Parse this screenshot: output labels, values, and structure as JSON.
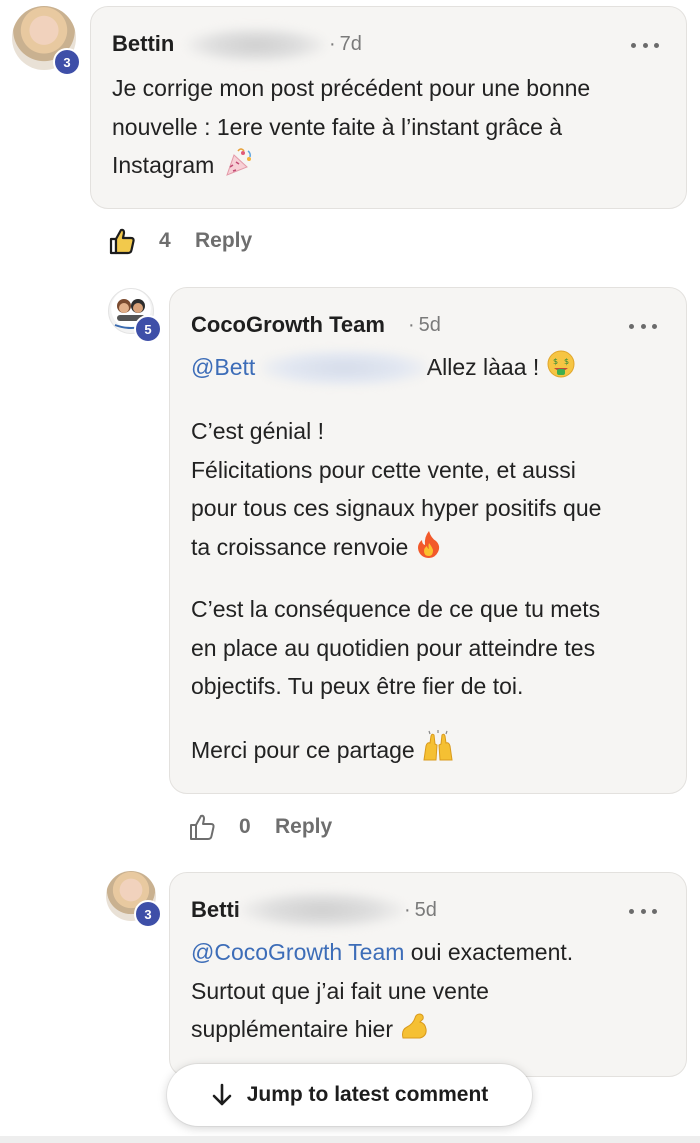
{
  "comments": [
    {
      "author": "Bettin",
      "time": "7d",
      "badge": "3",
      "lines": [
        "Je corrige mon post précédent pour une bonne",
        "nouvelle : 1ere vente faite à l’instant grâce à",
        "Instagram"
      ],
      "emoji_name": "party-popper-icon",
      "likes": "4",
      "reply_label": "Reply"
    },
    {
      "author": "CocoGrowth Team",
      "time": "5d",
      "badge": "5",
      "mention": "@Bett",
      "mention_after": "Allez làaa !",
      "paragraphs": [
        [
          "C’est génial !",
          "Félicitations pour cette vente, et aussi",
          "pour tous ces signaux hyper positifs que",
          "ta croissance renvoie"
        ],
        [
          "C’est la conséquence de ce que tu mets",
          "en place au quotidien pour atteindre tes",
          "objectifs. Tu peux être fier de toi."
        ],
        [
          "Merci pour ce partage"
        ]
      ],
      "likes": "0",
      "reply_label": "Reply"
    },
    {
      "author": "Betti",
      "time": "5d",
      "badge": "3",
      "mention": "@CocoGrowth Team",
      "lines": [
        "oui exactement.",
        "Surtout que j’ai fait une vente",
        "supplémentaire hier"
      ]
    }
  ],
  "jump_button": {
    "label": "Jump to latest comment"
  },
  "colors": {
    "badge": "#3e4fa8",
    "mention": "#3d6db8",
    "bubble": "#f6f5f3"
  }
}
